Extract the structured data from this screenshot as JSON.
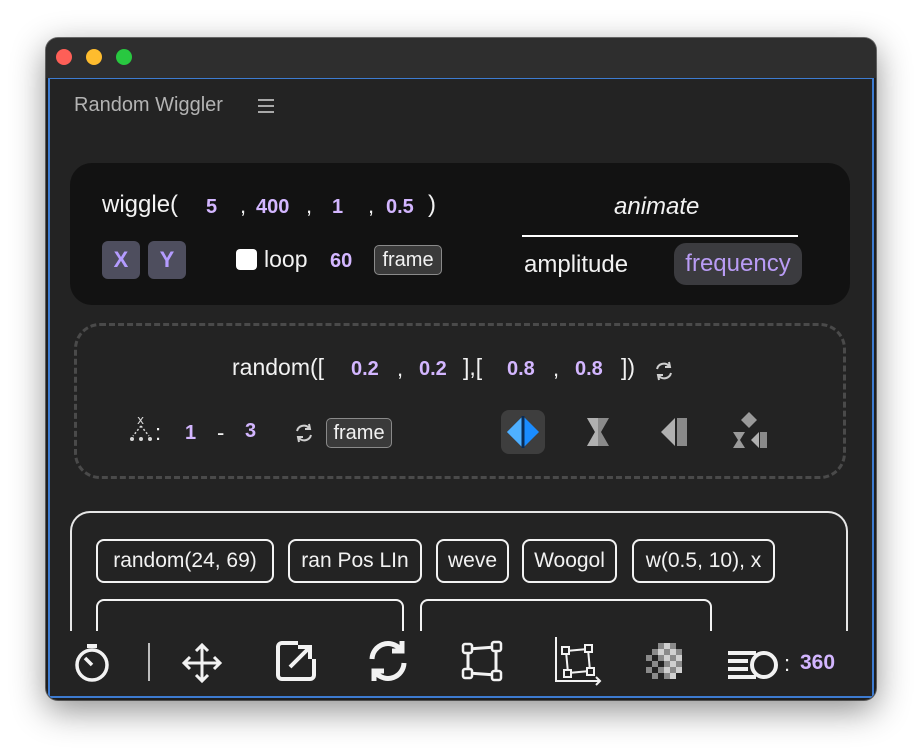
{
  "window": {
    "title": "Random Wiggler"
  },
  "wiggle": {
    "prefix": "wiggle(",
    "freq": "5",
    "sep1": ",",
    "amp": "400",
    "sep2": ",",
    "octaves": "1",
    "sep3": ",",
    "amp_mult": "0.5",
    "suffix": ")",
    "x_label": "X",
    "y_label": "Y",
    "loop_label": "loop",
    "loop_value": "60",
    "frame_label": "frame"
  },
  "animate": {
    "title": "animate",
    "amplitude": "amplitude",
    "frequency": "frequency"
  },
  "random": {
    "prefix": "random([",
    "min_x": "0.2",
    "sep_a": ",",
    "min_y": "0.2",
    "mid": "],[",
    "max_x": "0.8",
    "sep_b": ",",
    "max_y": "0.8",
    "suffix": "])",
    "colon": ":",
    "range_from": "1",
    "range_dash": "-",
    "range_to": "3",
    "frame_label": "frame"
  },
  "presets": [
    "random(24,  69)",
    "ran Pos LIn",
    "weve",
    "Woogol",
    "w(0.5, 10), x"
  ],
  "toolbar": {
    "count_colon": ":",
    "count_value": "360"
  },
  "colors": {
    "accent_purple": "#d3b6ff",
    "active_blue": "#1a8cff",
    "panel_border": "#3d7bd0"
  }
}
